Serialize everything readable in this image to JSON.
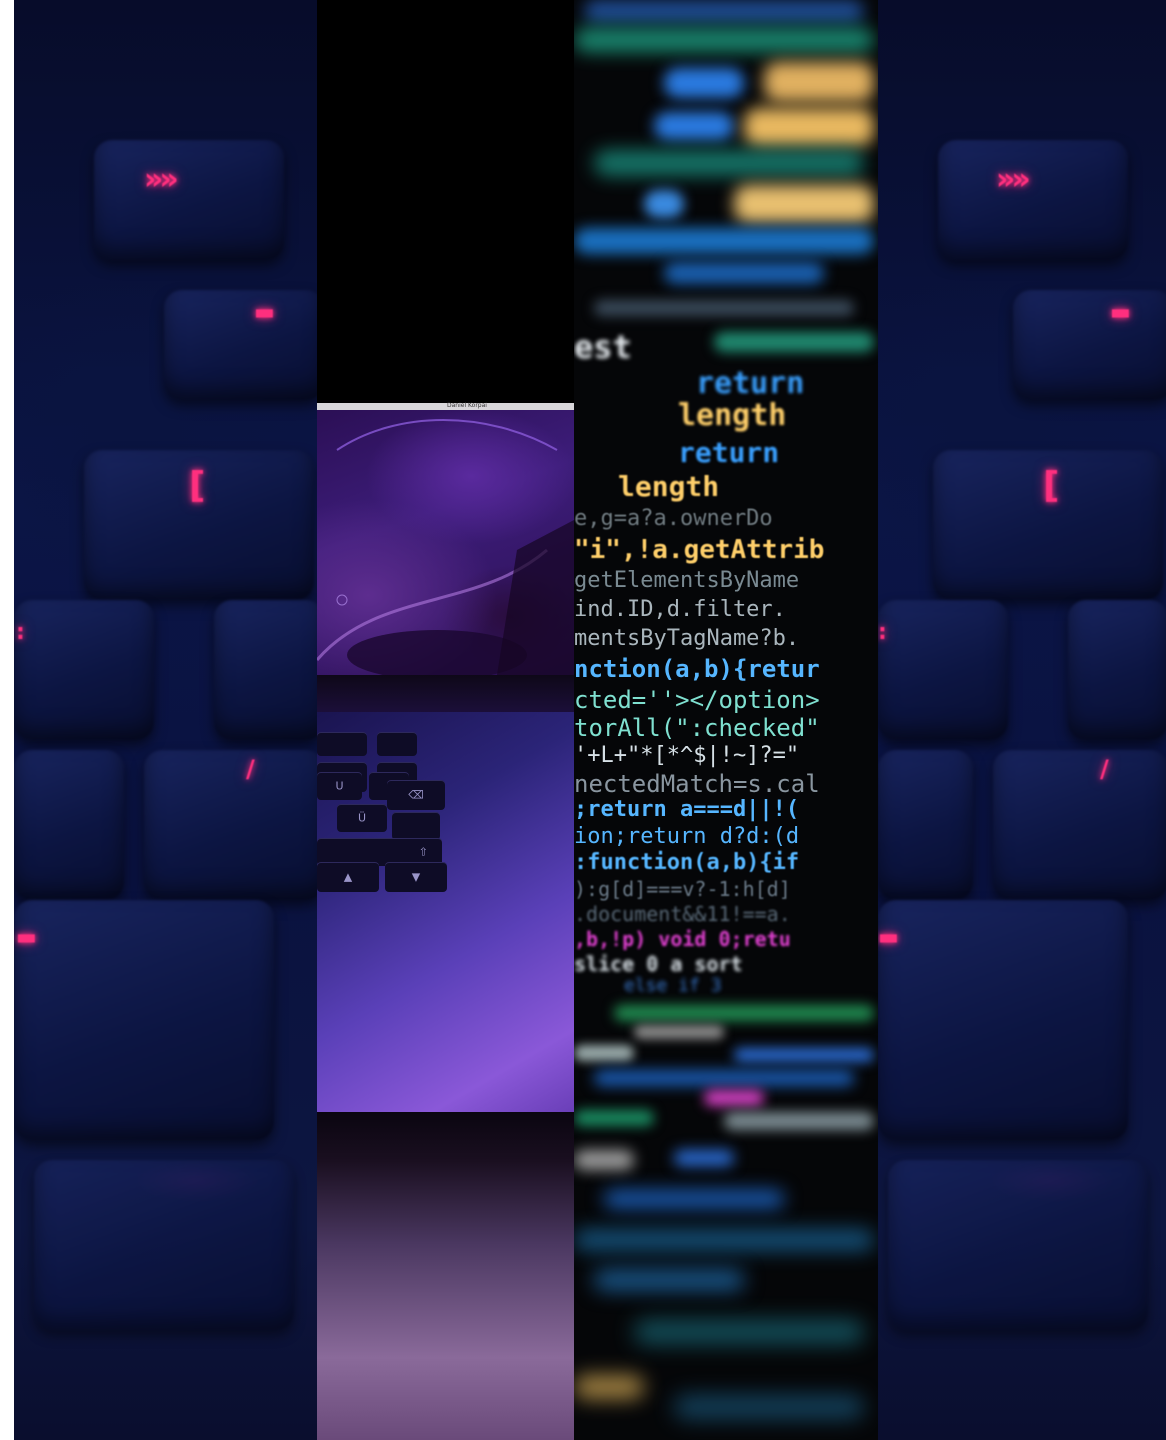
{
  "image": {
    "description_panels": [
      "keyboard-left",
      "laptop",
      "code",
      "keyboard-right"
    ]
  },
  "laptop": {
    "menubar_text": "Daniel Korpai",
    "key_labels": [
      "U",
      "Ü",
      "⌫",
      "⇧",
      "▲",
      "▼"
    ]
  },
  "code": {
    "lines": [
      "est",
      "return",
      "length",
      "return",
      "length",
      "e,g=a?a.ownerDo",
      "\"i\",!a.getAttrib",
      "getElementsByName",
      "ind.ID,d.filter.",
      "mentsByTagName?b.",
      "nction(a,b){retur",
      "cted=''></option>",
      "torAll(\":checked\"",
      "'+L+\"*[*^$|!~]?=\"",
      "nectedMatch=s.cal",
      ";return a===d||!(",
      "ion;return d?d:(d",
      ":function(a,b){if",
      "):g[d]===v?-1:h[d]",
      ".document&&11!==a.",
      ",b,!p) void 0;retu",
      "slice 0 a sort",
      "else if 3"
    ]
  }
}
